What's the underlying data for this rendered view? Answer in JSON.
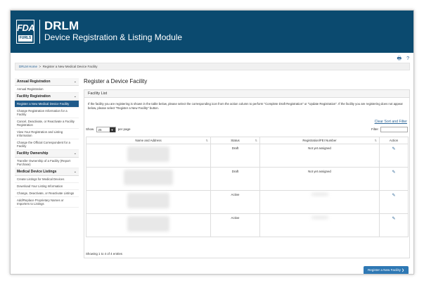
{
  "header": {
    "logo_top": "FDA",
    "logo_bottom": "FURLS",
    "title": "DRLM",
    "subtitle": "Device Registration & Listing Module"
  },
  "toolbar": {
    "print_icon": "print-icon",
    "help_icon": "help-icon",
    "print": "🖶",
    "help": "?"
  },
  "breadcrumb": {
    "home": "DRLM Home",
    "sep": ">",
    "current": "Register a New Medical Device Facility"
  },
  "sidebar": {
    "sections": [
      {
        "label": "Annual Registration",
        "items": [
          "Annual Registration"
        ]
      },
      {
        "label": "Facility Registration",
        "items": [
          "Register a New Medical Device Facility",
          "Change Registration Information for a Facility",
          "Cancel, Deactivate, or Reactivate a Facility Registration",
          "View Your Registration and Listing Information",
          "Change the Official Correspondent for a Facility"
        ]
      },
      {
        "label": "Facility Ownership",
        "items": [
          "Transfer Ownership of a Facility (Report Purchase)"
        ]
      },
      {
        "label": "Medical Device Listings",
        "items": [
          "Create Listings for Medical Devices",
          "Download Your Listing Information",
          "Change, Deactivate, or Reactivate Listings",
          "Add/Replace Proprietary Names or Importers to Listings"
        ]
      }
    ],
    "active_item": "Register a New Medical Device Facility"
  },
  "main": {
    "title": "Register a Device Facility",
    "panel_title": "Facility List",
    "intro": "If the facility you are registering is shown in the table below, please select the corresponding icon from the action column to perform \"Complete Draft Registration\" or \"Update Registration\". If the facility you are registering does not appear below, please select \"Register a New Facility\" button.",
    "clear_link": "Clear Sort and Filter",
    "show_label": "Show",
    "per_page_value": "25",
    "per_page_label": "per page",
    "filter_label": "Filter",
    "columns": [
      "Name and Address",
      "Status",
      "Registration/FEI Number",
      "Action"
    ],
    "rows": [
      {
        "status": "Draft",
        "reg": "Not yet assigned"
      },
      {
        "status": "Draft",
        "reg": "Not yet assigned"
      },
      {
        "status": "Active",
        "reg": ""
      },
      {
        "status": "Active",
        "reg": ""
      }
    ],
    "showing": "Showing 1 to 4 of 4 entries",
    "new_facility_button": "Register a New Facility ❯"
  },
  "colors": {
    "header_bg": "#0b4a6f",
    "accent": "#2e78b4",
    "active_nav": "#1f5a8a"
  }
}
